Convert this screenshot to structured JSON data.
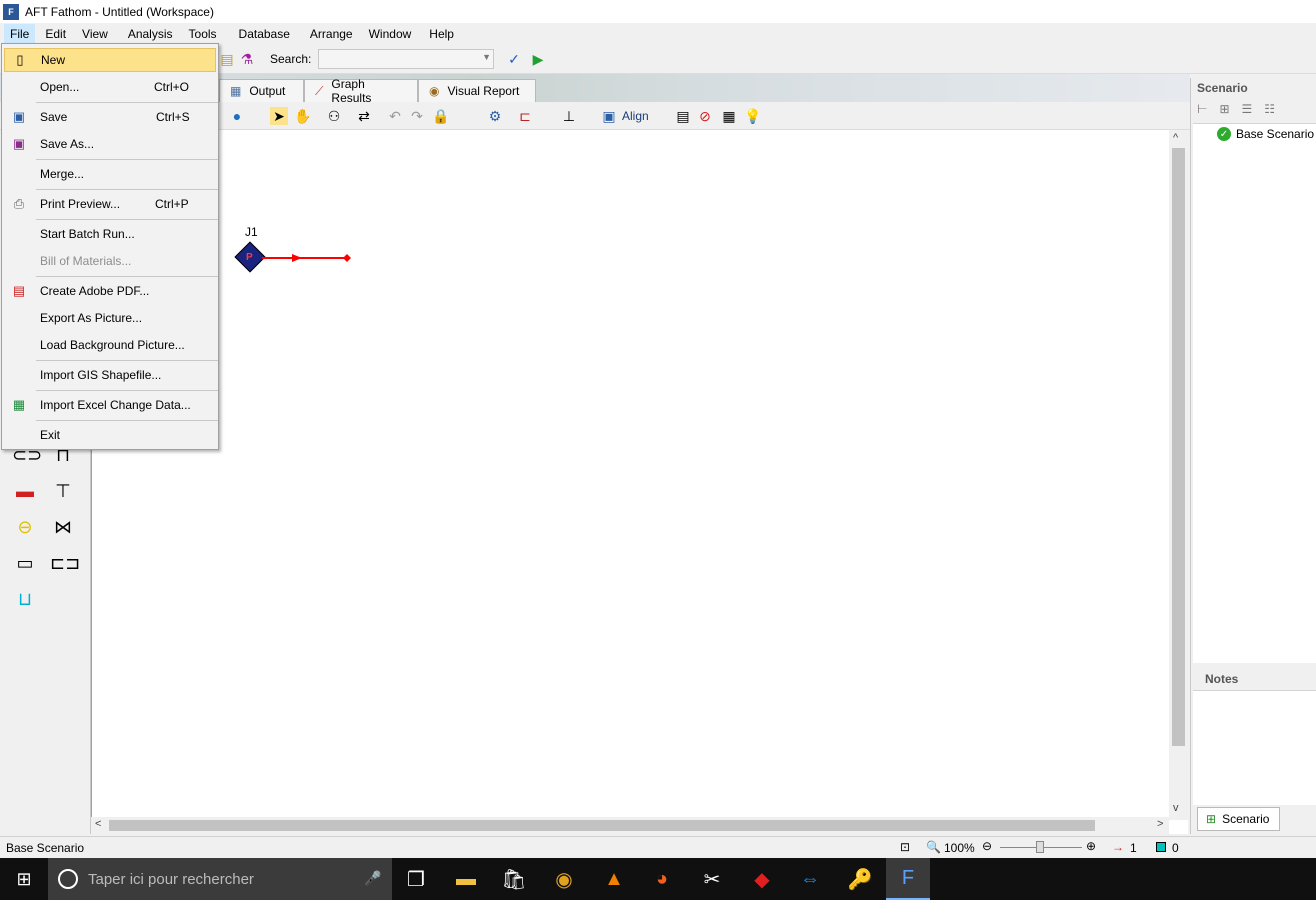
{
  "window": {
    "title": "AFT Fathom - Untitled (Workspace)",
    "app_icon": "F"
  },
  "menubar": [
    "File",
    "Edit",
    "View",
    "Analysis",
    "Tools",
    "Database",
    "Arrange",
    "Window",
    "Help"
  ],
  "toolbar": {
    "search_label": "Search:",
    "search_value": "",
    "align_label": "Align"
  },
  "tabs": [
    {
      "label": "Output",
      "icon": "table-icon"
    },
    {
      "label": "Graph Results",
      "icon": "graph-icon"
    },
    {
      "label": "Visual Report",
      "icon": "eye-icon"
    }
  ],
  "canvas": {
    "junction_label": "J1",
    "junction_letter": "P",
    "pipe_color": "#ff0000",
    "junction_color": "#1a237e"
  },
  "file_menu": {
    "items": [
      {
        "label": "New",
        "shortcut": "",
        "icon": "new-file-icon",
        "enabled": true,
        "highlighted": true
      },
      {
        "label": "Open...",
        "shortcut": "Ctrl+O",
        "icon": "",
        "enabled": true
      },
      {
        "label": "Save",
        "shortcut": "Ctrl+S",
        "icon": "save-icon",
        "enabled": true
      },
      {
        "label": "Save As...",
        "shortcut": "",
        "icon": "save-as-icon",
        "enabled": true
      },
      {
        "label": "Merge...",
        "shortcut": "",
        "icon": "",
        "enabled": true
      },
      {
        "label": "Print Preview...",
        "shortcut": "Ctrl+P",
        "icon": "printer-icon",
        "enabled": true
      },
      {
        "label": "Start Batch Run...",
        "shortcut": "",
        "icon": "",
        "enabled": true
      },
      {
        "label": "Bill of Materials...",
        "shortcut": "",
        "icon": "",
        "enabled": false
      },
      {
        "label": "Create Adobe PDF...",
        "shortcut": "",
        "icon": "pdf-icon",
        "enabled": true
      },
      {
        "label": "Export As Picture...",
        "shortcut": "",
        "icon": "",
        "enabled": true
      },
      {
        "label": "Load Background Picture...",
        "shortcut": "",
        "icon": "",
        "enabled": true
      },
      {
        "label": "Import GIS Shapefile...",
        "shortcut": "",
        "icon": "",
        "enabled": true
      },
      {
        "label": "Import Excel Change Data...",
        "shortcut": "",
        "icon": "excel-icon",
        "enabled": true
      },
      {
        "label": "Exit",
        "shortcut": "",
        "icon": "",
        "enabled": true
      }
    ]
  },
  "right_panel": {
    "scenario_header": "Scenario",
    "base_scenario": "Base Scenario",
    "notes_header": "Notes",
    "scenario_tab": "Scenario"
  },
  "status_bar": {
    "scenario": "Base Scenario",
    "zoom": "100%",
    "pipe_count": "1",
    "junction_count": "0"
  },
  "taskbar": {
    "search_placeholder": "Taper ici pour rechercher"
  },
  "colors": {
    "menu_highlight": "#fde28c",
    "accent": "#2b5797"
  }
}
